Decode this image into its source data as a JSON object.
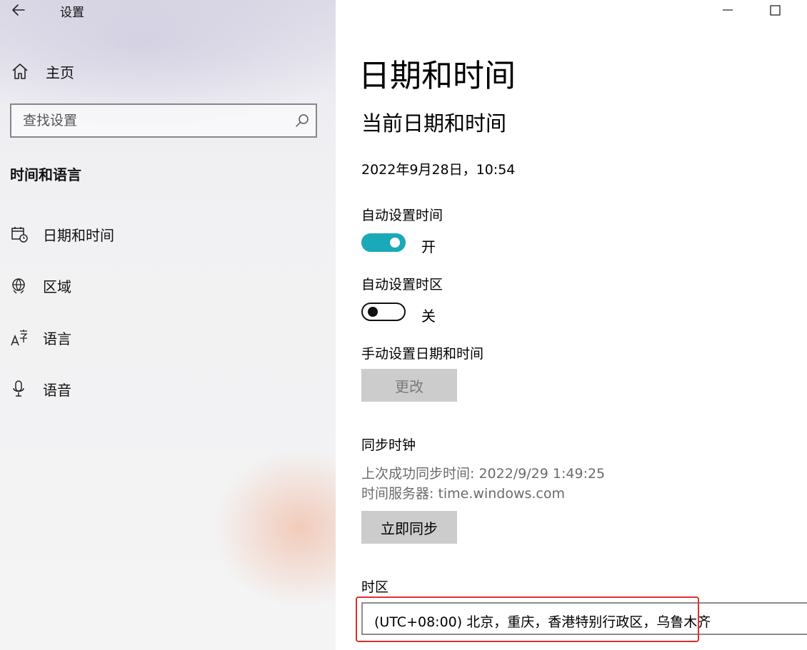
{
  "window": {
    "title": "设置"
  },
  "sidebar": {
    "home_label": "主页",
    "search_placeholder": "查找设置",
    "section_title": "时间和语言",
    "items": [
      {
        "label": "日期和时间",
        "icon": "calendar-clock-icon"
      },
      {
        "label": "区域",
        "icon": "globe-icon"
      },
      {
        "label": "语言",
        "icon": "language-icon"
      },
      {
        "label": "语音",
        "icon": "microphone-icon"
      }
    ]
  },
  "main": {
    "page_title": "日期和时间",
    "section_title": "当前日期和时间",
    "current_datetime": "2022年9月28日，10:54",
    "auto_time": {
      "label": "自动设置时间",
      "state": "开",
      "on": true
    },
    "auto_timezone": {
      "label": "自动设置时区",
      "state": "关",
      "on": false
    },
    "manual": {
      "label": "手动设置日期和时间",
      "button": "更改"
    },
    "sync": {
      "label": "同步时钟",
      "last_sync": "上次成功同步时间: 2022/9/29 1:49:25",
      "server": "时间服务器: time.windows.com",
      "button": "立即同步"
    },
    "timezone": {
      "label": "时区",
      "value": "(UTC+08:00) 北京，重庆，香港特别行政区，乌鲁木齐"
    }
  },
  "colors": {
    "toggle_on": "#1aa9b8",
    "highlight": "#e0302f",
    "button_bg": "#cccccc"
  }
}
